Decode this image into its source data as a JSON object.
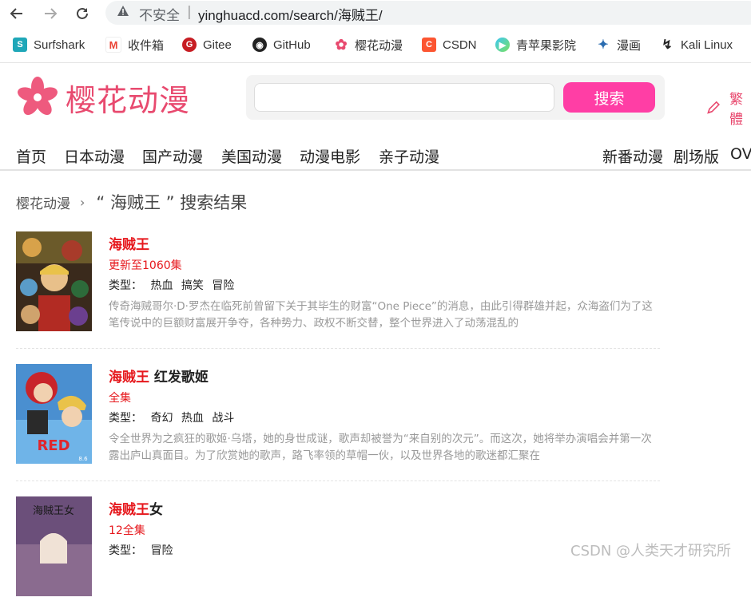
{
  "browser": {
    "insecure_label": "不安全",
    "url": "yinghuacd.com/search/海贼王/",
    "bookmarks": [
      {
        "label": "Surfshark",
        "icon": "surfshark-icon"
      },
      {
        "label": "收件箱",
        "icon": "gmail-icon"
      },
      {
        "label": "Gitee",
        "icon": "gitee-icon"
      },
      {
        "label": "GitHub",
        "icon": "github-icon"
      },
      {
        "label": "樱花动漫",
        "icon": "sakura-icon"
      },
      {
        "label": "CSDN",
        "icon": "csdn-icon"
      },
      {
        "label": "青苹果影院",
        "icon": "apple-cinema-icon"
      },
      {
        "label": "漫画",
        "icon": "manhua-icon"
      },
      {
        "label": "Kali Linux",
        "icon": "kali-icon"
      }
    ]
  },
  "site": {
    "logo_text": "樱花动漫",
    "search_button": "搜索",
    "traditional_label": "繁體",
    "brand_color": "#e84a6f",
    "accent_color": "#ff3ea5"
  },
  "nav": {
    "left": [
      "首页",
      "日本动漫",
      "国产动漫",
      "美国动漫",
      "动漫电影",
      "亲子动漫"
    ],
    "right": [
      "新番动漫",
      "剧场版",
      "OVA"
    ]
  },
  "breadcrumb": {
    "site": "樱花动漫",
    "query_display": "“ 海贼王 ”  搜索结果"
  },
  "type_label": "类型：",
  "results": [
    {
      "title_highlight": "海贼王",
      "title_rest": "",
      "episodes": "更新至1060集",
      "tags": [
        "热血",
        "搞笑",
        "冒险"
      ],
      "description": "传奇海贼哥尔·D·罗杰在临死前曾留下关于其毕生的财富“One Piece”的消息，由此引得群雄并起，众海盗们为了这笔传说中的巨额财富展开争夺，各种势力、政权不断交替，整个世界进入了动荡混乱的"
    },
    {
      "title_highlight": "海贼王",
      "title_rest": " 红发歌姬",
      "episodes": "全集",
      "tags": [
        "奇幻",
        "热血",
        "战斗"
      ],
      "description": "令全世界为之疯狂的歌姬·乌塔，她的身世成谜，歌声却被誉为“来自别的次元”。而这次，她将举办演唱会并第一次露出庐山真面目。为了欣赏她的歌声，路飞率领的草帽一伙，以及世界各地的歌迷都汇聚在"
    },
    {
      "title_highlight": "海贼王",
      "title_rest": "女",
      "episodes": "12全集",
      "tags": [
        "冒险"
      ],
      "description": ""
    }
  ],
  "poster_text": {
    "p2_big": "RED",
    "p2_small": "8.6",
    "p3_title": "海贼王女"
  },
  "watermark": "CSDN @人类天才研究所"
}
